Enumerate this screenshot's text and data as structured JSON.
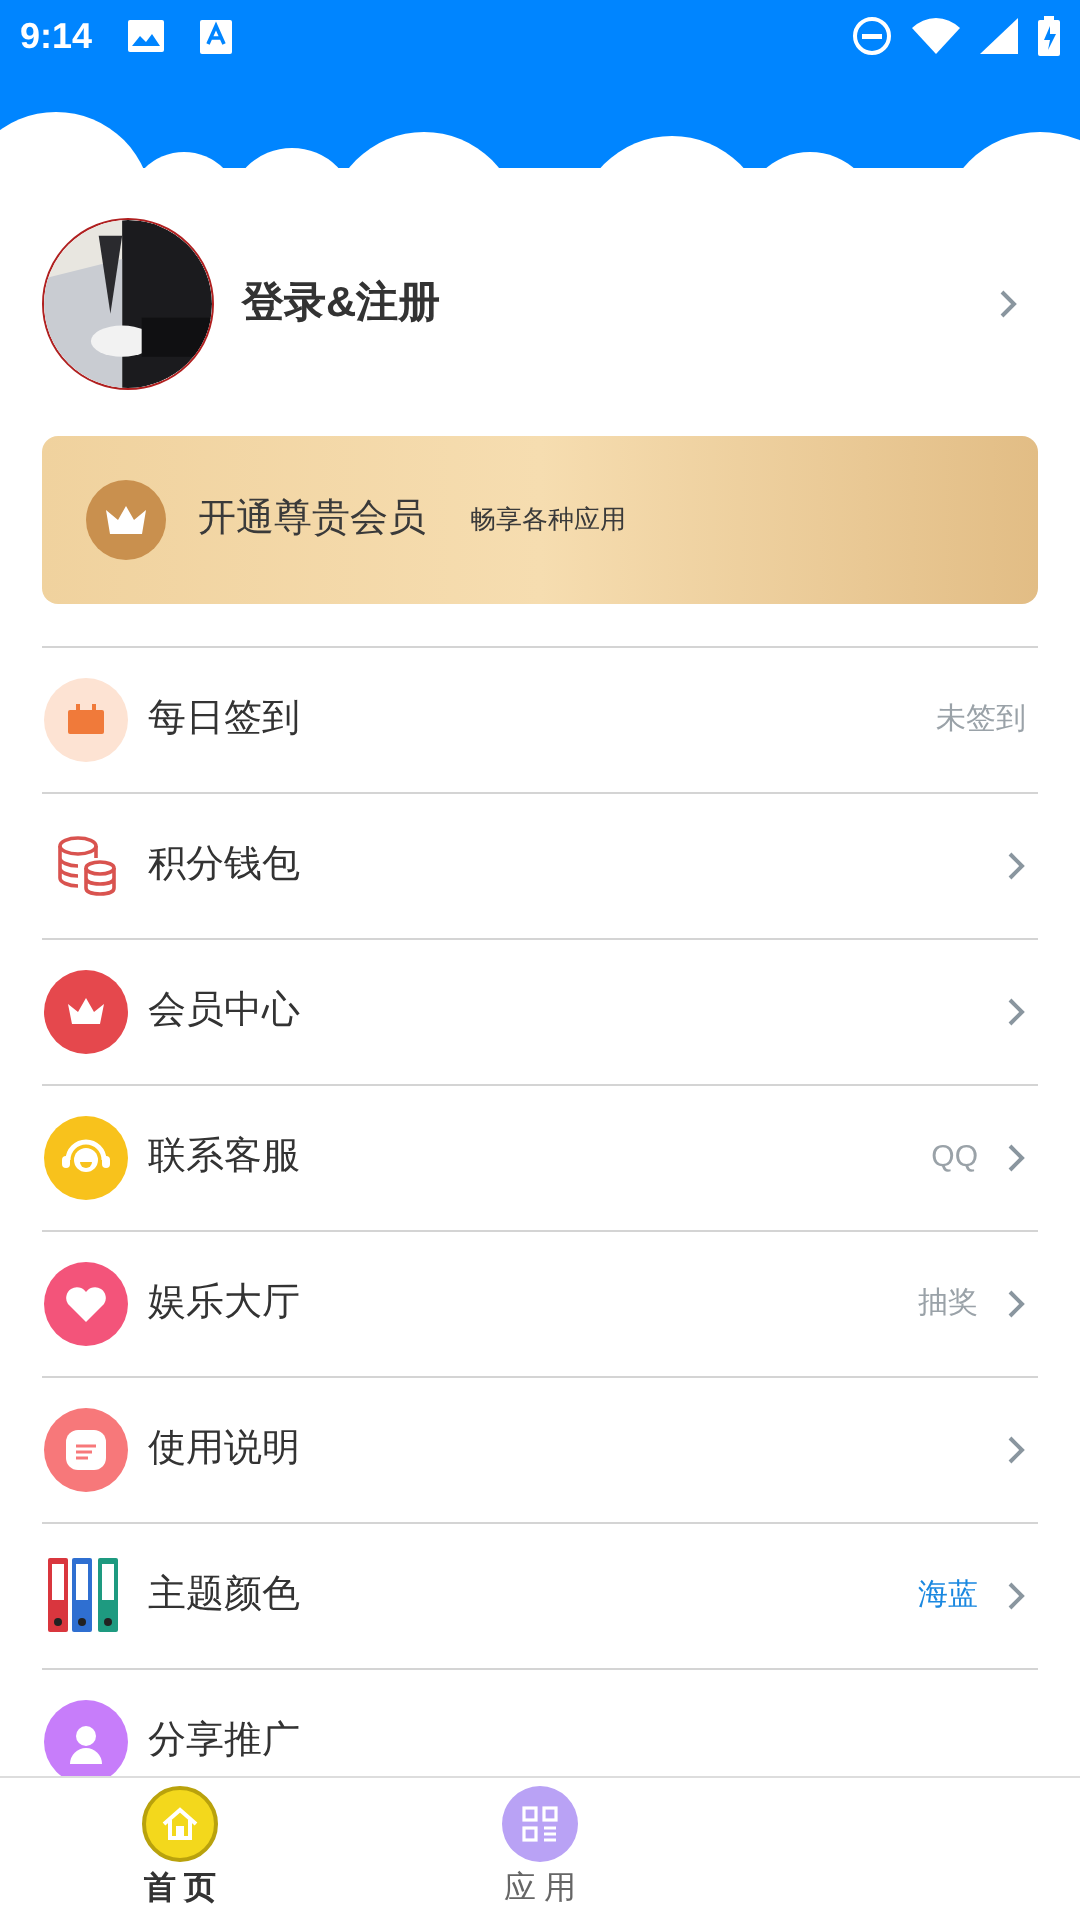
{
  "status_bar": {
    "time": "9:14"
  },
  "profile": {
    "name": "登录&注册"
  },
  "vip_banner": {
    "title": "开通尊贵会员",
    "subtitle": "畅享各种应用"
  },
  "menu": [
    {
      "label": "每日签到",
      "note": "未签到",
      "accent": false,
      "chevron": false
    },
    {
      "label": "积分钱包",
      "chevron": true
    },
    {
      "label": "会员中心",
      "chevron": true
    },
    {
      "label": "联系客服",
      "note": "QQ",
      "accent": false,
      "chevron": true
    },
    {
      "label": "娱乐大厅",
      "note": "抽奖",
      "accent": false,
      "chevron": true
    },
    {
      "label": "使用说明",
      "chevron": true
    },
    {
      "label": "主题颜色",
      "note": "海蓝",
      "accent": true,
      "chevron": true
    },
    {
      "label": "分享推广",
      "chevron": false
    }
  ],
  "bottom_nav": [
    {
      "label": "首 页",
      "selected": true
    },
    {
      "label": "应 用",
      "selected": false
    }
  ]
}
